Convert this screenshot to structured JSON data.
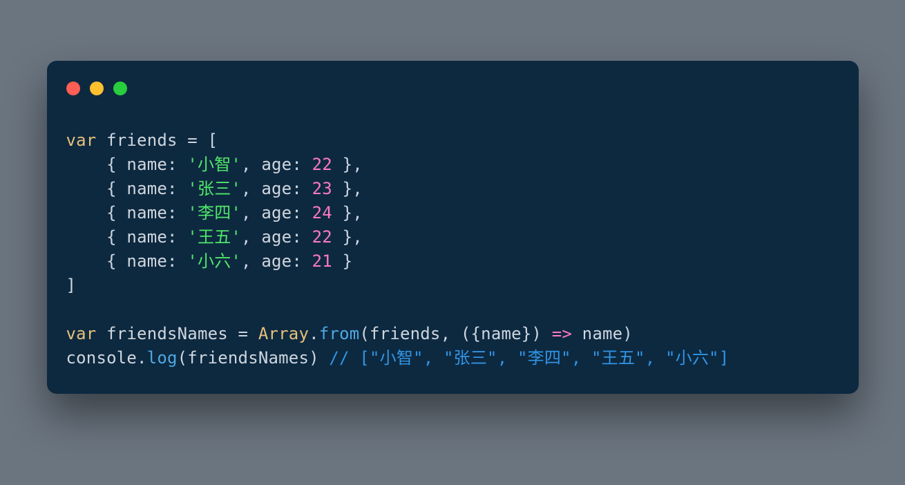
{
  "colors": {
    "background": "#6b7580",
    "editor_bg": "#0d2940",
    "red_light": "#ff5e55",
    "yellow_light": "#ffc02e",
    "green_light": "#29ce3e"
  },
  "code": {
    "line1": {
      "kw_var": "var",
      "space1": " ",
      "name": "friends",
      "assign": " = [",
      "rest": ""
    },
    "entries": [
      {
        "indent": "    ",
        "open": "{ ",
        "key1": "name",
        "colon1": ": ",
        "str": "'小智'",
        "comma1": ", ",
        "key2": "age",
        "colon2": ": ",
        "num": "22",
        "close": " },"
      },
      {
        "indent": "    ",
        "open": "{ ",
        "key1": "name",
        "colon1": ": ",
        "str": "'张三'",
        "comma1": ", ",
        "key2": "age",
        "colon2": ": ",
        "num": "23",
        "close": " },"
      },
      {
        "indent": "    ",
        "open": "{ ",
        "key1": "name",
        "colon1": ": ",
        "str": "'李四'",
        "comma1": ", ",
        "key2": "age",
        "colon2": ": ",
        "num": "24",
        "close": " },"
      },
      {
        "indent": "    ",
        "open": "{ ",
        "key1": "name",
        "colon1": ": ",
        "str": "'王五'",
        "comma1": ", ",
        "key2": "age",
        "colon2": ": ",
        "num": "22",
        "close": " },"
      },
      {
        "indent": "    ",
        "open": "{ ",
        "key1": "name",
        "colon1": ": ",
        "str": "'小六'",
        "comma1": ", ",
        "key2": "age",
        "colon2": ": ",
        "num": "21",
        "close": " }"
      }
    ],
    "close_array": "]",
    "blank": "",
    "line9": {
      "kw_var": "var",
      "space1": " ",
      "name": "friendsNames",
      "assign": " = ",
      "class": "Array",
      "dot": ".",
      "method": "from",
      "args_open": "(friends, ({name}) ",
      "arrow": "=>",
      "args_close": " name)"
    },
    "line10": {
      "console": "console",
      "dot": ".",
      "log": "log",
      "args": "(friendsNames) ",
      "comment": "// [\"小智\", \"张三\", \"李四\", \"王五\", \"小六\"]"
    }
  }
}
